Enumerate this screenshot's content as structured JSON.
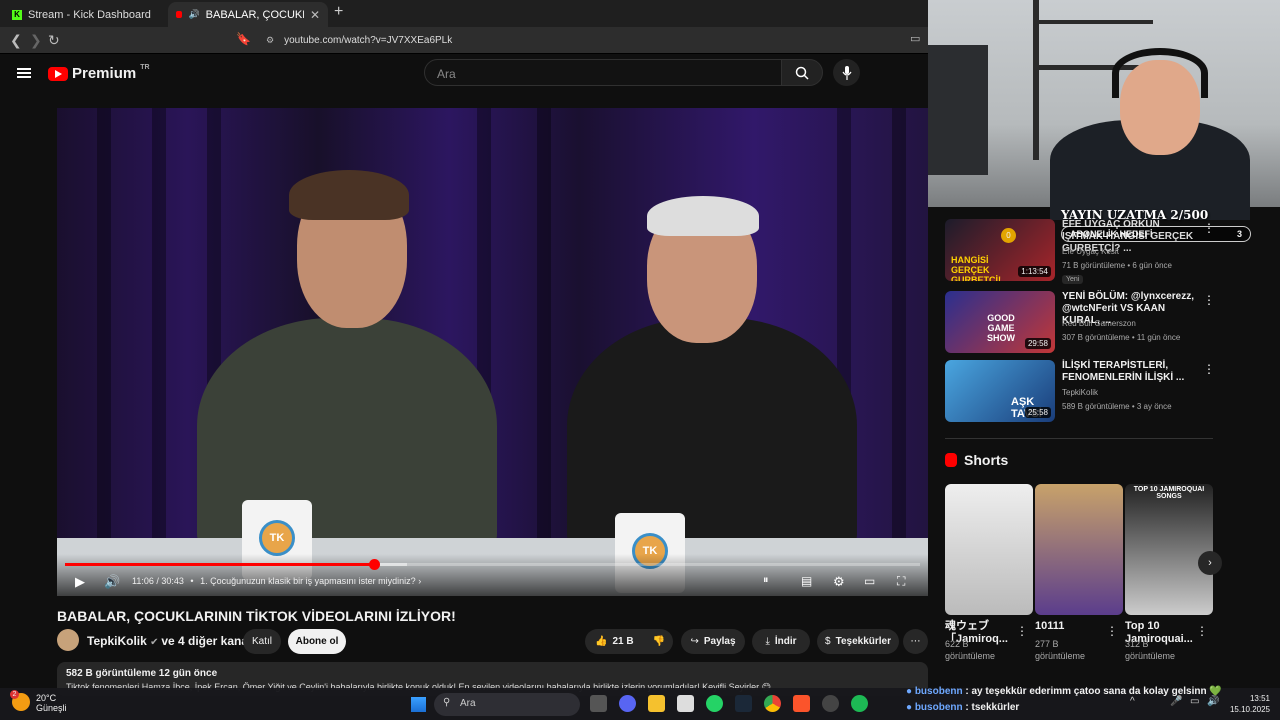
{
  "browser": {
    "tabs": [
      {
        "label": "Stream - Kick Dashboard"
      },
      {
        "label": "BABALAR, ÇOCUKLARININ TİKTOK VİDEOLARINI İZLİYOR!",
        "short": "BABALAR, ÇOCUKLARININ Tİ"
      }
    ],
    "url": "youtube.com/watch?v=JV7XXEa6PLk"
  },
  "youtube": {
    "logo_text": "Premium",
    "region": "TR",
    "search_placeholder": "Ara"
  },
  "player": {
    "time": "11:06 / 30:43",
    "chapter": "1. Çocuğunuzun klasik bir iş yapmasını ister miydiniz?",
    "progress_fraction": 0.361,
    "buffered_fraction": 0.4,
    "mug_logo": "TK"
  },
  "video": {
    "title": "BABALAR, ÇOCUKLARININ TİKTOK VİDEOLARINI İZLİYOR!",
    "channel": "TepkiKolik",
    "channel_extra": "ve 4 diğer kanal",
    "join_label": "Katıl",
    "subscribe_label": "Abone ol",
    "likes": "21 B",
    "share_label": "Paylaş",
    "download_label": "İndir",
    "thanks_label": "Teşekkürler",
    "views_line": "582 B görüntüleme  12 gün önce",
    "desc_line": "Tiktok fenomenleri Hamza İbce, İpek Ercan, Ömer Yiğit ve Ceylin'i babalarıyla birlikte konuk olduk! En sevilen videolarını babalarıyla birlikte izlerin yorumladılar! Keyifli Seyirler 😊"
  },
  "overlay": {
    "stream_goal": "YAYIN UZATMA 2/500",
    "sub_goal_label": "ABONELİK HEDEFİ",
    "sub_goal_count": "3",
    "sub_goal_badge": "0"
  },
  "sidebar": {
    "videos": [
      {
        "title": "EFE UYGAÇ ORKUN IŞITMAK HANGİSİ GERÇEK GURBETÇİ? ...",
        "channel": "Efe Uygaç Kesit",
        "meta": "71 B görüntüleme • 6 gün önce",
        "duration": "1:13:54",
        "badge": "Yeni",
        "thumb_text": "HANGİSİ GERÇEK GURBETÇİ!"
      },
      {
        "title": "YENİ BÖLÜM: @lynxcerezz, @wtcNFerit VS KAAN KURAL, ...",
        "channel": "Red Bull Gamerszon",
        "meta": "307 B görüntüleme • 11 gün önce",
        "duration": "29:58",
        "thumb_text": "GOOD GAME SHOW"
      },
      {
        "title": "İLİŞKİ TERAPİSTLERİ, FENOMENLERİN İLİŞKİ ...",
        "channel": "TepkiKolik",
        "meta": "589 B görüntüleme • 3 ay önce",
        "duration": "25:58",
        "thumb_text": "AŞK TAVSİ"
      }
    ],
    "shorts_heading": "Shorts",
    "shorts": [
      {
        "title": "魂ウェブ「Jamiroq...",
        "views": "622 B görüntüleme"
      },
      {
        "title": "10111",
        "views": "277 B görüntüleme"
      },
      {
        "title": "Top 10 Jamiroquai...",
        "views": "312 B görüntüleme",
        "thumb_text": "TOP 10 JAMIROQUAI SONGS"
      }
    ]
  },
  "chat": [
    {
      "user": "busobenn",
      "message": ": ay teşekkür ederimm çatoo sana da kolay gelsinn 💚"
    },
    {
      "user": "busobenn",
      "message": ": tsekkürler"
    }
  ],
  "taskbar": {
    "temperature": "20°C",
    "weather": "Güneşli",
    "search_label": "Ara",
    "time": "13:51",
    "date": "15.10.2025",
    "weather_badge": "2"
  },
  "colors": {
    "accent": "#ff0000",
    "bg": "#0f0f0f",
    "chat_user": "#6ea8ff"
  }
}
